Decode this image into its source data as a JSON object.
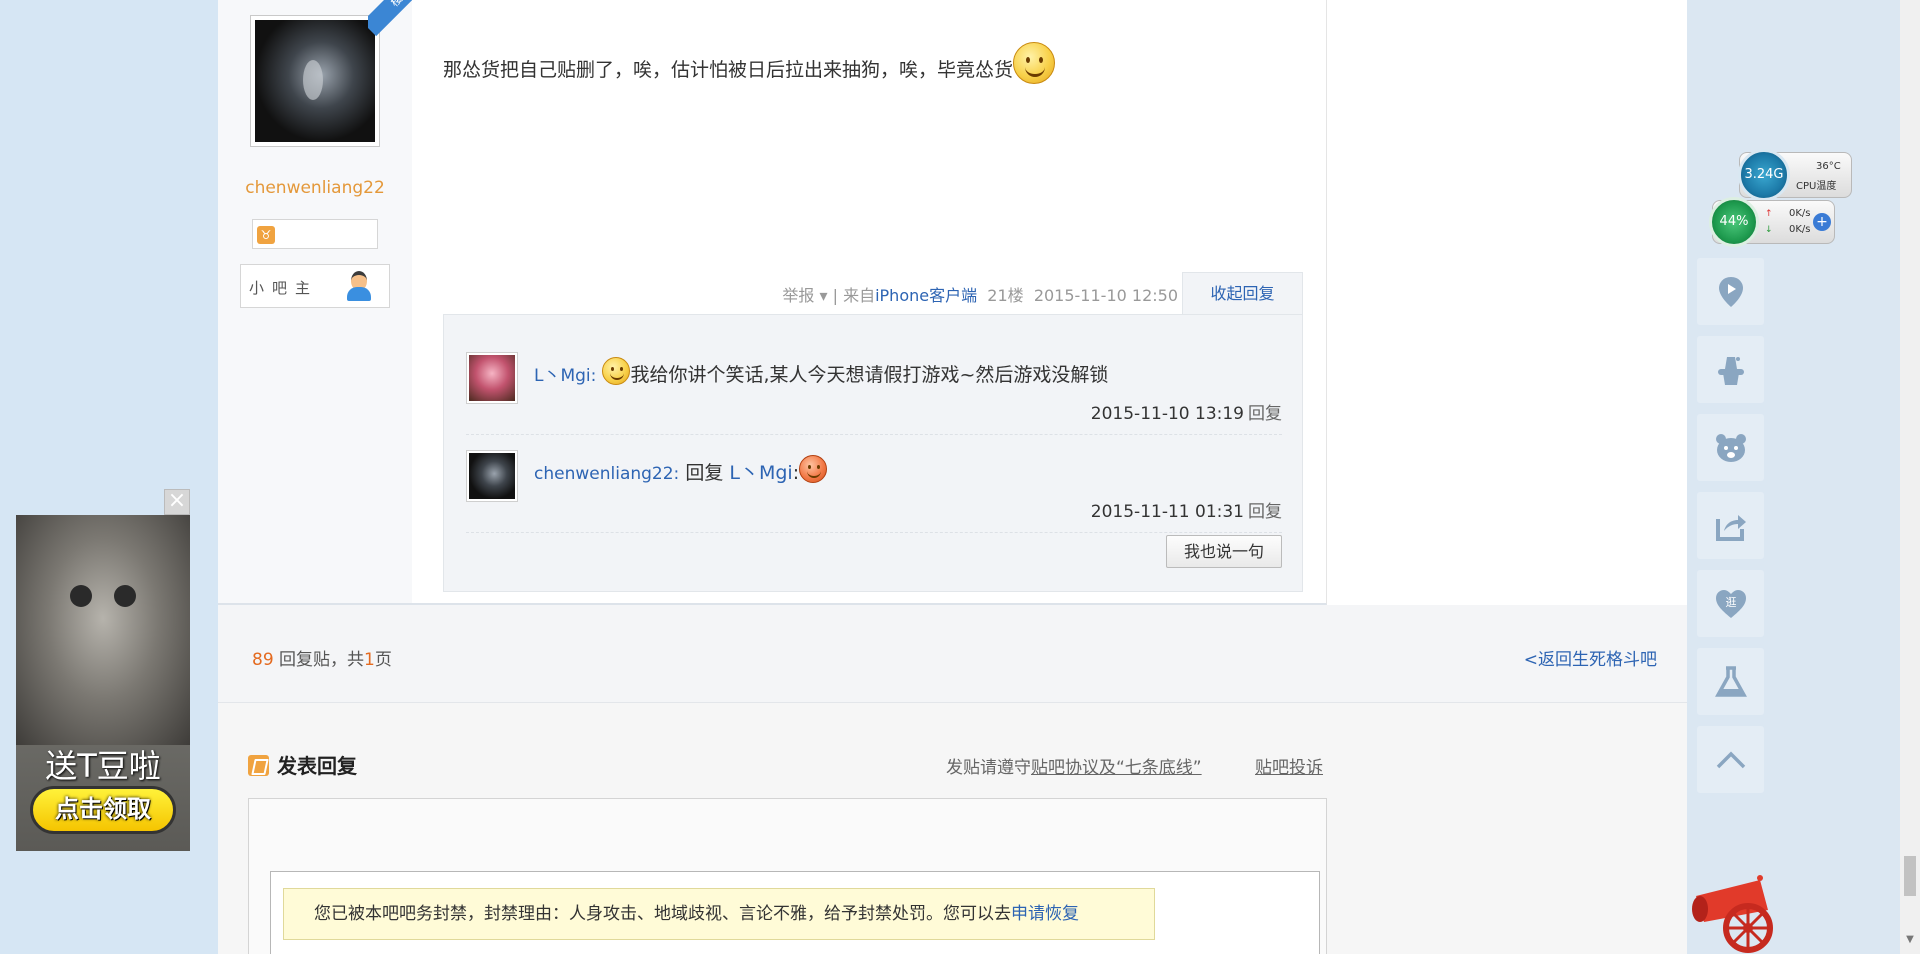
{
  "post": {
    "author_name": "chenwenliang22",
    "corner_badge": "楼主",
    "role_label": "小吧主",
    "text": "那怂货把自己贴删了，唉，估计怕被日后拉出来抽狗，唉，毕竟怂货",
    "meta": {
      "report": "举报",
      "sep": "| 来自",
      "client": "iPhone客户端",
      "floor": "21楼",
      "time": "2015-11-10 12:50"
    },
    "collapse_label": "收起回复"
  },
  "replies": [
    {
      "user": "L丶Mgi:",
      "text": "我给你讲个笑话,某人今天想请假打游戏~然后游戏没解锁",
      "time": "2015-11-10 13:19",
      "reply_label": "回复"
    },
    {
      "user": "chenwenliang22:",
      "prefix": "回复",
      "target": "L丶Mgi",
      "suffix": ":",
      "time": "2015-11-11 01:31",
      "reply_label": "回复"
    }
  ],
  "say_button": "我也说一句",
  "pager": {
    "count": "89",
    "label_mid": "回复贴，共",
    "pages": "1",
    "label_end": "页",
    "back_link": "<返回生死格斗吧"
  },
  "editor": {
    "title": "发表回复",
    "rules_prefix": "发贴请遵守",
    "rules_link": "贴吧协议及“七条底线”",
    "complaint": "贴吧投诉",
    "ban_notice": "您已被本吧吧务封禁，封禁理由：人身攻击、地域歧视、言论不雅，给予封禁处罚。您可以去",
    "ban_link": "申请恢复"
  },
  "monitor": {
    "cpu_freq": "3.24G",
    "cpu_temp": "36°C",
    "cpu_label": "CPU温度",
    "mem_pct": "44%",
    "up_speed": "0K/s",
    "down_speed": "0K/s"
  },
  "ad": {
    "text": "送T豆啦",
    "button": "点击领取"
  },
  "icons": [
    "location-icon",
    "magic-hat-icon",
    "bear-icon",
    "share-icon",
    "heart-shop-icon",
    "flask-icon",
    "back-to-top-icon"
  ]
}
